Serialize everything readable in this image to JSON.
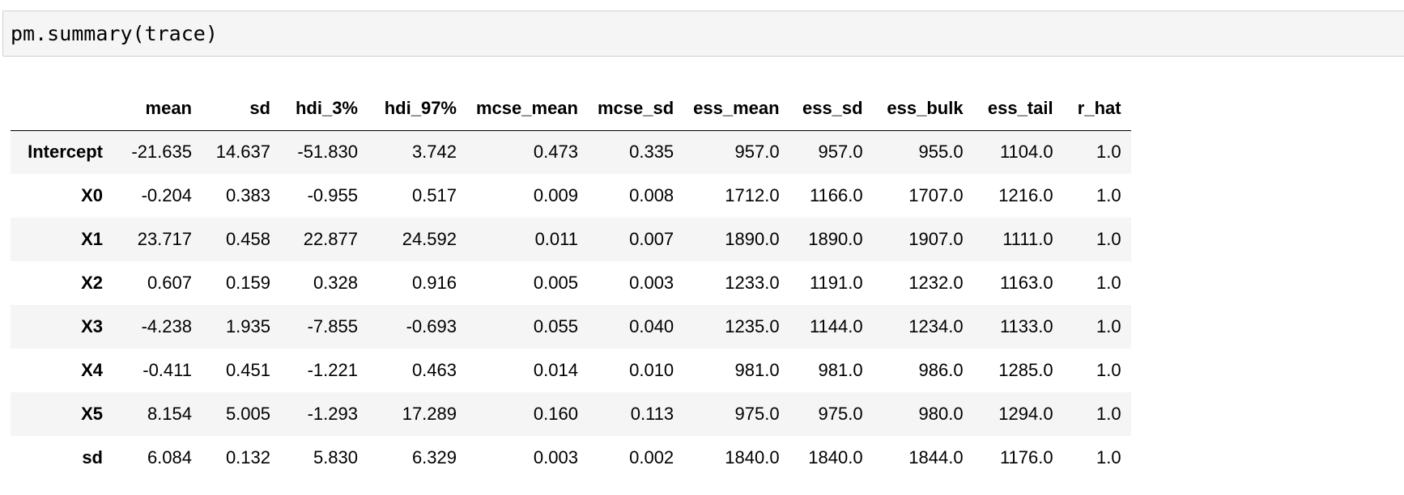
{
  "code_cell": {
    "source": "pm.summary(trace)"
  },
  "summary_table": {
    "columns": [
      "",
      "mean",
      "sd",
      "hdi_3%",
      "hdi_97%",
      "mcse_mean",
      "mcse_sd",
      "ess_mean",
      "ess_sd",
      "ess_bulk",
      "ess_tail",
      "r_hat"
    ],
    "rows": [
      {
        "label": "Intercept",
        "values": [
          "-21.635",
          "14.637",
          "-51.830",
          "3.742",
          "0.473",
          "0.335",
          "957.0",
          "957.0",
          "955.0",
          "1104.0",
          "1.0"
        ]
      },
      {
        "label": "X0",
        "values": [
          "-0.204",
          "0.383",
          "-0.955",
          "0.517",
          "0.009",
          "0.008",
          "1712.0",
          "1166.0",
          "1707.0",
          "1216.0",
          "1.0"
        ]
      },
      {
        "label": "X1",
        "values": [
          "23.717",
          "0.458",
          "22.877",
          "24.592",
          "0.011",
          "0.007",
          "1890.0",
          "1890.0",
          "1907.0",
          "1111.0",
          "1.0"
        ]
      },
      {
        "label": "X2",
        "values": [
          "0.607",
          "0.159",
          "0.328",
          "0.916",
          "0.005",
          "0.003",
          "1233.0",
          "1191.0",
          "1232.0",
          "1163.0",
          "1.0"
        ]
      },
      {
        "label": "X3",
        "values": [
          "-4.238",
          "1.935",
          "-7.855",
          "-0.693",
          "0.055",
          "0.040",
          "1235.0",
          "1144.0",
          "1234.0",
          "1133.0",
          "1.0"
        ]
      },
      {
        "label": "X4",
        "values": [
          "-0.411",
          "0.451",
          "-1.221",
          "0.463",
          "0.014",
          "0.010",
          "981.0",
          "981.0",
          "986.0",
          "1285.0",
          "1.0"
        ]
      },
      {
        "label": "X5",
        "values": [
          "8.154",
          "5.005",
          "-1.293",
          "17.289",
          "0.160",
          "0.113",
          "975.0",
          "975.0",
          "980.0",
          "1294.0",
          "1.0"
        ]
      },
      {
        "label": "sd",
        "values": [
          "6.084",
          "0.132",
          "5.830",
          "6.329",
          "0.003",
          "0.002",
          "1840.0",
          "1840.0",
          "1844.0",
          "1176.0",
          "1.0"
        ]
      }
    ]
  },
  "colors": {
    "cell_background": "#f5f5f5",
    "cell_border": "#cfcfcf",
    "row_stripe": "#f5f5f5",
    "text": "#000000"
  }
}
